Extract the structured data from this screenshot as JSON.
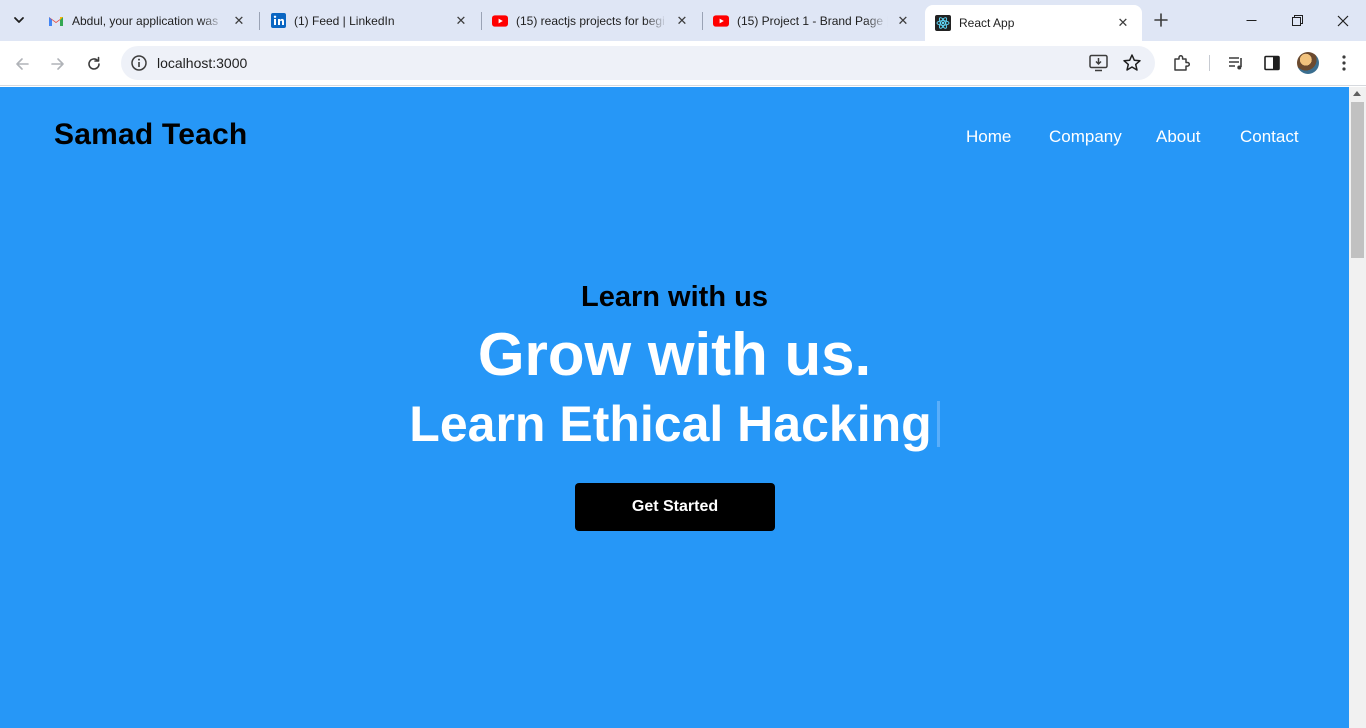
{
  "browser": {
    "tabs": [
      {
        "title": "Abdul, your application was",
        "icon": "gmail-icon"
      },
      {
        "title": "(1) Feed | LinkedIn",
        "icon": "linkedin-icon"
      },
      {
        "title": "(15) reactjs projects for begi",
        "icon": "youtube-icon"
      },
      {
        "title": "(15) Project 1 - Brand Page |",
        "icon": "youtube-icon"
      },
      {
        "title": "React App",
        "icon": "react-icon",
        "active": true
      }
    ],
    "url": "localhost:3000"
  },
  "page": {
    "brand": "Samad Teach",
    "nav": [
      "Home",
      "Company",
      "About",
      "Contact"
    ],
    "hero": {
      "eyebrow": "Learn with us",
      "headline": "Grow with us.",
      "typed_text": "Learn Ethical Hacking",
      "cta_label": "Get Started"
    },
    "colors": {
      "background": "#2697f7",
      "cta_background": "#000000",
      "cursor": "#5aaefa"
    }
  }
}
